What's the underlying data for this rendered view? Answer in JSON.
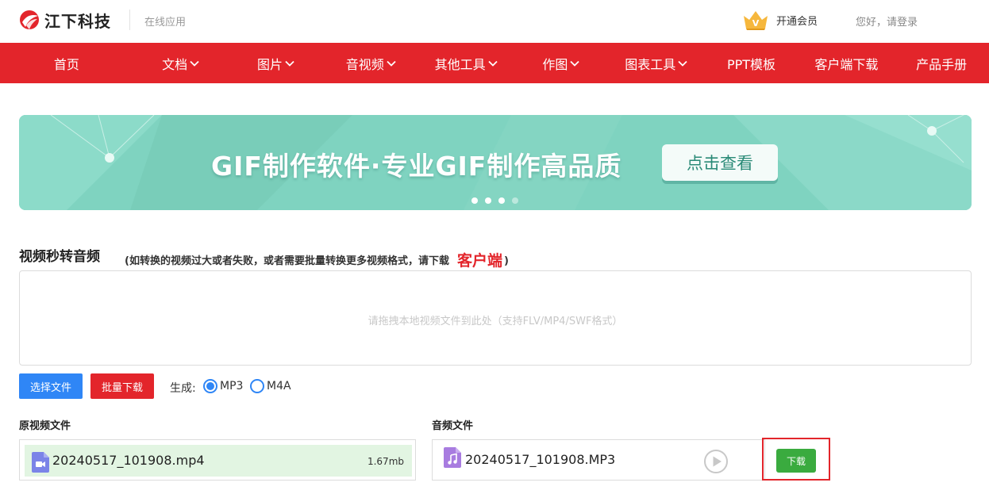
{
  "header": {
    "logo_text": "江下科技",
    "subtitle": "在线应用",
    "vip_label": "开通会员",
    "login_label": "您好，请登录"
  },
  "nav": {
    "items": [
      {
        "label": "首页",
        "dropdown": false
      },
      {
        "label": "文档",
        "dropdown": true
      },
      {
        "label": "图片",
        "dropdown": true
      },
      {
        "label": "音视频",
        "dropdown": true
      },
      {
        "label": "其他工具",
        "dropdown": true
      },
      {
        "label": "作图",
        "dropdown": true
      },
      {
        "label": "图表工具",
        "dropdown": true
      },
      {
        "label": "PPT模板",
        "dropdown": false
      },
      {
        "label": "客户端下载",
        "dropdown": false
      },
      {
        "label": "产品手册",
        "dropdown": false
      }
    ]
  },
  "banner": {
    "title": "GIF制作软件·专业GIF制作高品质",
    "button_label": "点击查看",
    "active_slide": 3,
    "slide_count": 4
  },
  "tool": {
    "title": "视频秒转音频",
    "note_prefix": "(如转换的视频过大或者失败，或者需要批量转换更多视频格式，请下载",
    "note_link": "客户端",
    "note_suffix": ")",
    "drop_hint": "请拖拽本地视频文件到此处（支持FLV/MP4/SWF格式）",
    "select_button": "选择文件",
    "batch_button": "批量下载",
    "generate_label": "生成:",
    "formats": [
      {
        "label": "MP3",
        "selected": true
      },
      {
        "label": "M4A",
        "selected": false
      }
    ]
  },
  "source": {
    "label": "原视频文件",
    "filename": "20240517_101908.mp4",
    "size": "1.67mb"
  },
  "output": {
    "label": "音频文件",
    "filename": "20240517_101908.MP3",
    "download_button": "下载"
  },
  "colors": {
    "brand_red": "#e3252b",
    "primary_blue": "#2f86f6",
    "banner_teal": "#7fd3c0",
    "success_green": "#3aab3f",
    "file_row_bg": "#e2f5e2"
  },
  "icons": {
    "logo": "jiangxia-logo",
    "vip": "crown-icon",
    "video_file": "video-file-icon",
    "audio_file": "audio-file-icon",
    "play": "play-icon"
  }
}
